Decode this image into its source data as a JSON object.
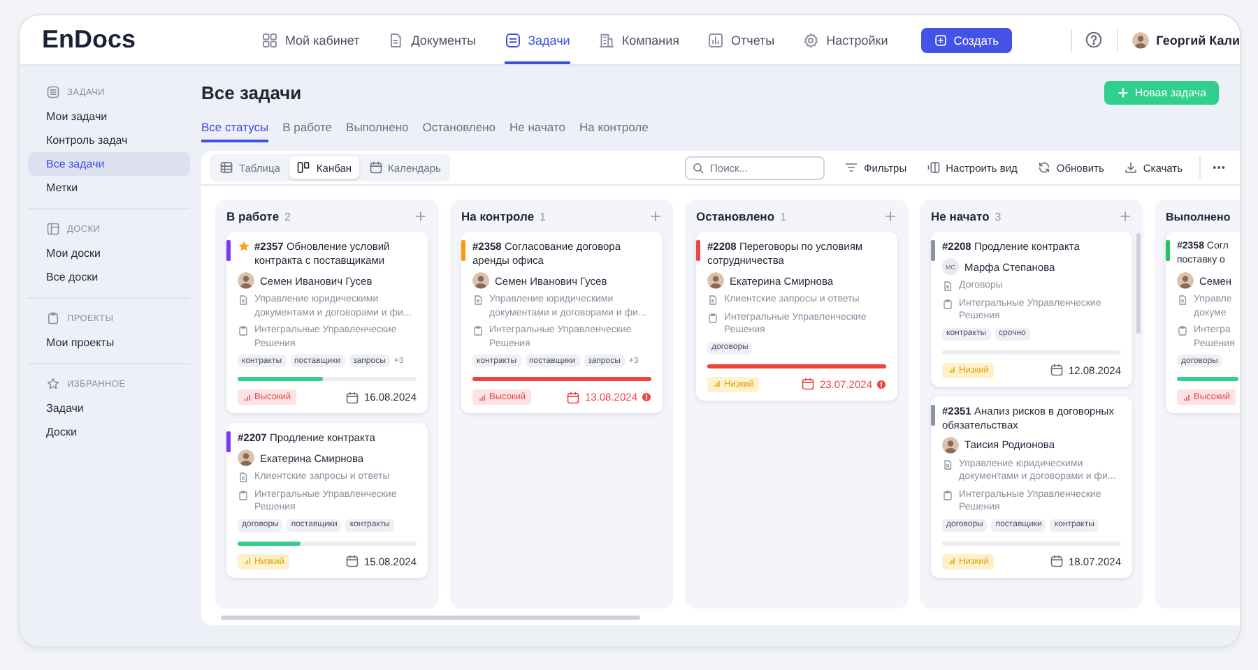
{
  "header": {
    "logo": "EnDocs",
    "nav": [
      {
        "label": "Мой кабинет",
        "selected": false
      },
      {
        "label": "Документы",
        "selected": false
      },
      {
        "label": "Задачи",
        "selected": true
      },
      {
        "label": "Компания",
        "selected": false
      },
      {
        "label": "Отчеты",
        "selected": false
      },
      {
        "label": "Настройки",
        "selected": false
      }
    ],
    "create_button": "Создать",
    "user": {
      "name": "Георгий Кали"
    }
  },
  "sidebar": {
    "sections": [
      {
        "title": "ЗАДАЧИ",
        "items": [
          {
            "label": "Мои задачи",
            "selected": false
          },
          {
            "label": "Контроль задач",
            "selected": false
          },
          {
            "label": "Все задачи",
            "selected": true
          },
          {
            "label": "Метки",
            "selected": false
          }
        ]
      },
      {
        "title": "ДОСКИ",
        "items": [
          {
            "label": "Мои доски",
            "selected": false
          },
          {
            "label": "Все доски",
            "selected": false
          }
        ]
      },
      {
        "title": "ПРОЕКТЫ",
        "items": [
          {
            "label": "Мои проекты",
            "selected": false
          }
        ]
      },
      {
        "title": "ИЗБРАННОЕ",
        "items": [
          {
            "label": "Задачи",
            "selected": false
          },
          {
            "label": "Доски",
            "selected": false
          }
        ]
      }
    ]
  },
  "page": {
    "title": "Все задачи",
    "new_button": "Новая задача",
    "status_tabs": [
      {
        "label": "Все статусы",
        "selected": true
      },
      {
        "label": "В работе",
        "selected": false
      },
      {
        "label": "Выполнено",
        "selected": false
      },
      {
        "label": "Остановлено",
        "selected": false
      },
      {
        "label": "Не начато",
        "selected": false
      },
      {
        "label": "На контроле",
        "selected": false
      }
    ]
  },
  "toolbar": {
    "views": [
      {
        "label": "Таблица",
        "selected": false
      },
      {
        "label": "Канбан",
        "selected": true
      },
      {
        "label": "Календарь",
        "selected": false
      }
    ],
    "search": {
      "placeholder": "Поиск..."
    },
    "actions": [
      "Фильтры",
      "Настроить вид",
      "Обновить",
      "Скачать"
    ]
  },
  "columns": [
    {
      "title": "В работе",
      "count": "2",
      "cards": [
        {
          "color": "#7c3aed",
          "starred": true,
          "title": "**#2357** Обновление условий контракта с поставщиками",
          "assignee": {
            "name": "Семен Иванович Гусев"
          },
          "project": "Управление юридическими документами и договорами и фи...",
          "company": "Интегральные Управленческие Решения",
          "tags": [
            "контракты",
            "поставщики",
            "запросы"
          ],
          "more_tags": "+3",
          "level": 0.48,
          "priority": {
            "kind": "high",
            "label": "Высокий"
          },
          "date": "16.08.2024",
          "overdue": false
        },
        {
          "color": "#7c3aed",
          "starred": false,
          "title": "**#2207** Продление контракта",
          "assignee": {
            "name": "Екатерина Смирнова"
          },
          "project": "Клиентские запросы и ответы",
          "company": "Интегральные Управленческие Решения",
          "tags": [
            "договоры",
            "поставщики",
            "контракты"
          ],
          "level": 0.35,
          "priority": {
            "kind": "low",
            "label": "Низкий"
          },
          "date": "15.08.2024",
          "overdue": false
        }
      ]
    },
    {
      "title": "На контроле",
      "count": "1",
      "cards": [
        {
          "color": "#f59e0b",
          "starred": false,
          "title": "**#2358** Согласование договора аренды офиса",
          "assignee": {
            "name": "Семен Иванович Гусев"
          },
          "project": "Управление юридическими документами и договорами и фи...",
          "company": "Интегральные Управленческие Решения",
          "tags": [
            "контракты",
            "поставщики",
            "запросы"
          ],
          "more_tags": "+3",
          "level": 1,
          "priority": {
            "kind": "high",
            "label": "Высокий"
          },
          "date": "13.08.2024",
          "overdue": true
        }
      ]
    },
    {
      "title": "Остановлено",
      "count": "1",
      "cards": [
        {
          "color": "#ef4444",
          "starred": false,
          "title": "**#2208** Переговоры по условиям сотрудничества",
          "assignee": {
            "name": "Екатерина Смирнова"
          },
          "project": "Клиентские запросы и ответы",
          "company": "Интегральные Управленческие Решения",
          "tags": [
            "договоры"
          ],
          "level": 1,
          "priority": {
            "kind": "low",
            "label": "Низкий"
          },
          "date": "23.07.2024",
          "overdue": true
        }
      ]
    },
    {
      "title": "Не начато",
      "count": "3",
      "cards": [
        {
          "color": "#8b93a7",
          "starred": false,
          "title": "**#2208** Продление контракта",
          "assignee": {
            "name": "Марфа Степанова",
            "initials": "МС"
          },
          "project": "Договоры",
          "company": "Интегральные Управленческие Решения",
          "tags": [
            "контракты",
            "срочно"
          ],
          "level": 0,
          "priority": {
            "kind": "low",
            "label": "Низкий"
          },
          "date": "12.08.2024",
          "overdue": false
        },
        {
          "color": "#8b93a7",
          "starred": false,
          "title": "**#2351** Анализ рисков в договорных обязательствах",
          "assignee": {
            "name": "Таисия Родионова"
          },
          "project": "Управление юридическими документами и договорами и фи...",
          "company": "Интегральные Управленческие Решения",
          "tags": [
            "договоры",
            "поставщики",
            "контракты"
          ],
          "level": 0,
          "priority": {
            "kind": "low",
            "label": "Низкий"
          },
          "date": "18.07.2024",
          "overdue": false
        }
      ]
    },
    {
      "title": "Выполнено",
      "cards": [
        {
          "color": "#22c55e",
          "starred": false,
          "title": "**#2358** Согл поставку о",
          "assignee": {
            "name": "Семен"
          },
          "project": "Управле докуме",
          "company": "Интегра Решения",
          "tags": [
            "договоры"
          ],
          "level": 1,
          "priority": {
            "kind": "high",
            "label": "Высокий"
          }
        }
      ]
    }
  ]
}
